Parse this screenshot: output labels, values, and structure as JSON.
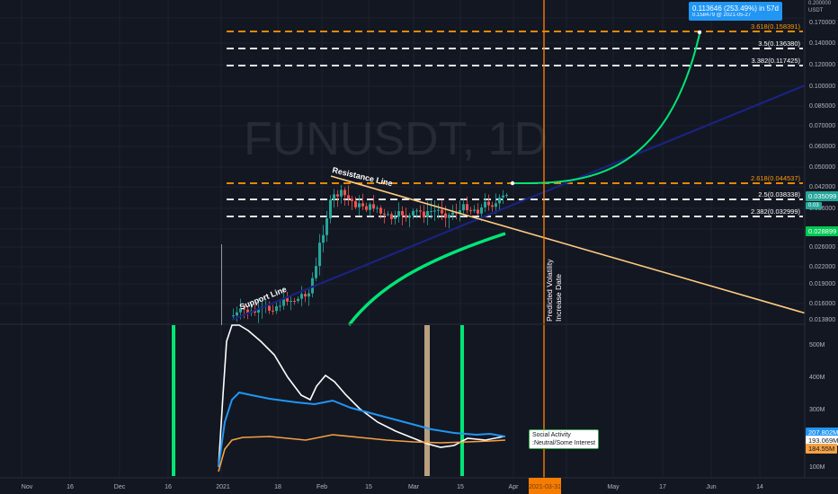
{
  "watermark": "FUNUSDT, 1D",
  "currency": "USDT",
  "price_axis": {
    "ticks": [
      "0.170000",
      "0.140000",
      "0.120000",
      "0.100000",
      "0.085000",
      "0.070000",
      "0.060000",
      "0.050000",
      "0.042000",
      "0.036000",
      "0.031000",
      "0.026000",
      "0.022000",
      "0.019000",
      "0.016000",
      "0.013800"
    ],
    "top_small": "0.200000",
    "current_price_tag": "0.035099",
    "current_price_sub": "0.03",
    "green_line_tag": "0.028899"
  },
  "volume_axis": {
    "ticks": [
      "500M",
      "400M",
      "300M",
      "100M"
    ],
    "tag_blue": "207.802M",
    "tag_white": "193.069M",
    "tag_orange": "184.55M"
  },
  "time_axis": {
    "labels": [
      "Nov",
      "16",
      "Dec",
      "16",
      "2021",
      "18",
      "Feb",
      "15",
      "Mar",
      "15",
      "Apr",
      "May",
      "17",
      "Jun",
      "14"
    ],
    "highlight": "2021-03-31"
  },
  "levels": [
    {
      "label": "3.618(0.158391)",
      "color": "#ff9800",
      "style": "dashed"
    },
    {
      "label": "3.5(0.136380)",
      "color": "#ffffff",
      "style": "dashed"
    },
    {
      "label": "3.382(0.117425)",
      "color": "#ffffff",
      "style": "dashed"
    },
    {
      "label": "2.618(0.044537)",
      "color": "#ff9800",
      "style": "dashed"
    },
    {
      "label": "2.5(0.038338)",
      "color": "#ffffff",
      "style": "dashed"
    },
    {
      "label": "2.382(0.032999)",
      "color": "#ffffff",
      "style": "dashed"
    }
  ],
  "annotations": {
    "resistance": "Resistance Line",
    "support": "Support Line",
    "volatility": "Predicted Volatility\nIncrease Date",
    "callout_line1": "0.113646 (253.49%) in 57d",
    "callout_line2": "0.158479 @ 2021-05-27",
    "social_line1": "Social Activity",
    "social_line2": ":Neutral/Some Interest"
  },
  "colors": {
    "background": "#131722",
    "grid": "#1e222d",
    "bull": "#26a69a",
    "bear": "#ef5350",
    "support": "#1a237e",
    "resistance": "#ffcc80",
    "projection": "#00e676",
    "volatility": "#f57c00",
    "white_line": "#ffffff",
    "blue_line": "#2196f3",
    "orange_line": "#f5a142"
  }
}
